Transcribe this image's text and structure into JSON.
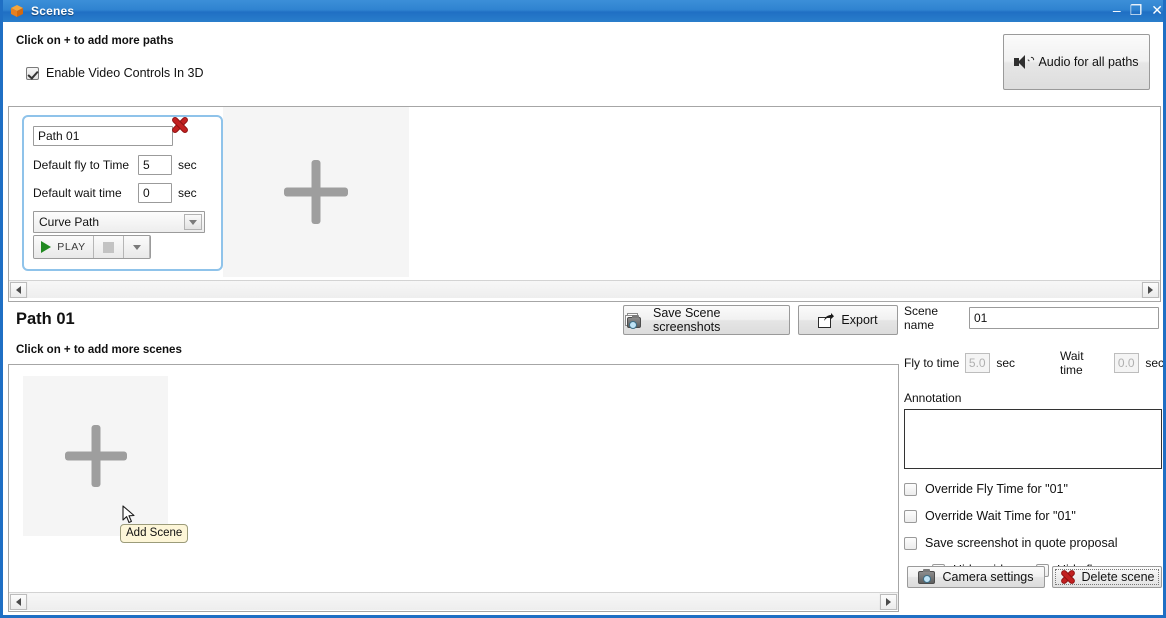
{
  "window": {
    "title": "Scenes",
    "app_icon": "box-3d-icon",
    "minimize_label": "–",
    "maximize_label": "❐",
    "close_label": "✕",
    "border_color": "#1f6fc4"
  },
  "header": {
    "paths_hint": "Click on + to add more paths",
    "enable_video_controls": {
      "label": "Enable Video Controls In 3D",
      "checked": true
    },
    "audio_button": {
      "label": "Audio for all paths",
      "icon": "speaker-icon"
    }
  },
  "paths_panel": {
    "add_path_tile": {
      "icon": "plus-icon",
      "tooltip": ""
    },
    "card": {
      "name_value": "Path 01",
      "delete_icon": "red-x-icon",
      "fly_to_time_label": "Default fly to Time",
      "fly_to_time_value": "5",
      "fly_to_time_unit": "sec",
      "wait_time_label": "Default wait time",
      "wait_time_value": "0",
      "wait_time_unit": "sec",
      "path_type_value": "Curve Path",
      "play_label": "PLAY",
      "stop_icon": "stop-square-icon",
      "more_icon": "chevron-down-icon"
    }
  },
  "scene_section": {
    "path_title": "Path 01",
    "scenes_hint": "Click on + to add more scenes",
    "save_screenshots_button": {
      "label": "Save Scene screenshots",
      "icon": "cameras-icon"
    },
    "export_button": {
      "label": "Export",
      "icon": "export-icon"
    },
    "add_scene_tile": {
      "icon": "plus-icon"
    },
    "tooltip": "Add Scene"
  },
  "properties": {
    "scene_name_label": "Scene name",
    "scene_name_value": "01",
    "fly_to_time_label": "Fly to time",
    "fly_to_time_value": "5.0",
    "fly_to_time_unit": "sec",
    "wait_time_label": "Wait time",
    "wait_time_value": "0.0",
    "wait_time_unit": "sec",
    "annotation_label": "Annotation",
    "annotation_value": "",
    "checkboxes": [
      {
        "label": "Override Fly Time for \"01\"",
        "checked": false
      },
      {
        "label": "Override Wait Time for \"01\"",
        "checked": false
      },
      {
        "label": "Save screenshot in quote proposal",
        "checked": false
      },
      {
        "label": "Hide grid",
        "checked": false
      },
      {
        "label": "Hide floor",
        "checked": false
      }
    ],
    "camera_settings_button": {
      "label": "Camera settings",
      "icon": "camera-icon"
    },
    "delete_scene_button": {
      "label": "Delete scene",
      "icon": "red-x-icon"
    }
  },
  "scrollbars": {
    "left_arrow": "chevron-left-icon",
    "right_arrow": "chevron-right-icon"
  }
}
